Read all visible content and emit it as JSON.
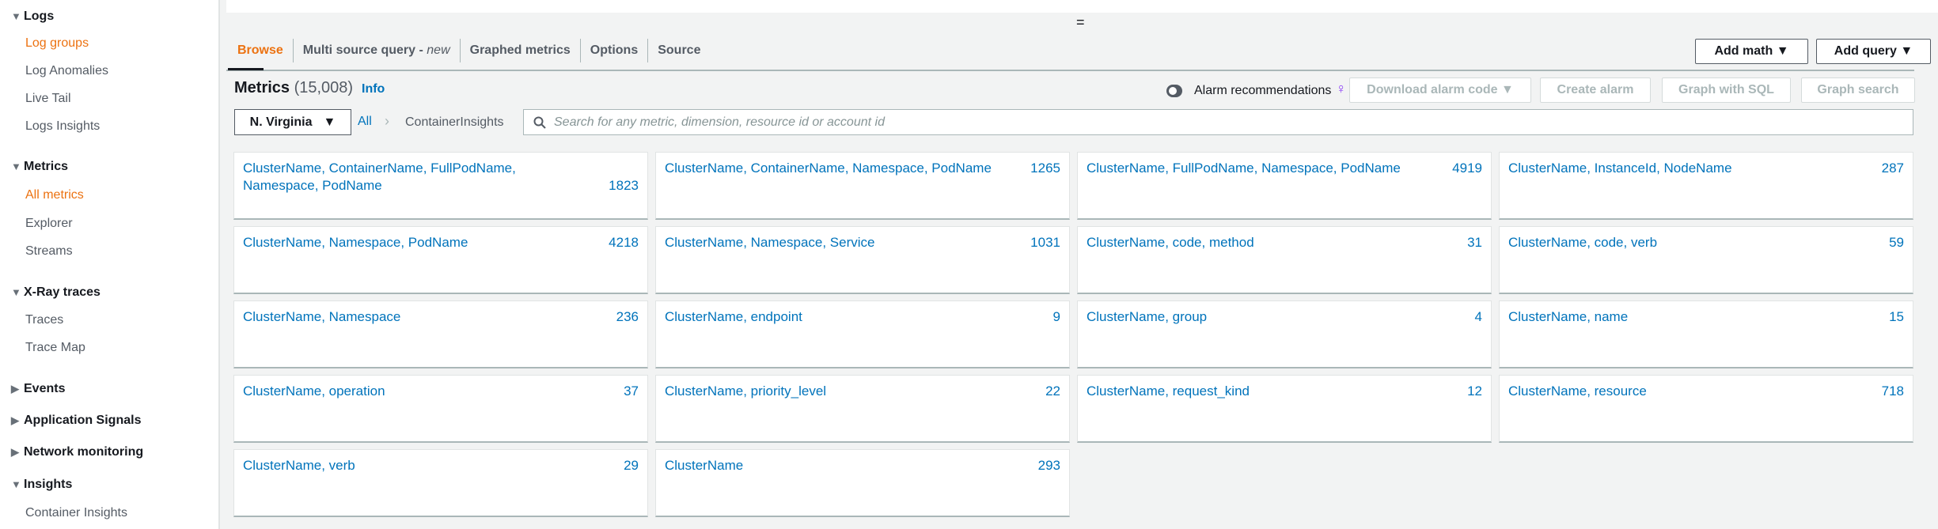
{
  "sidebar": {
    "items": [
      {
        "label": "Logs",
        "type": "header",
        "expanded": true
      },
      {
        "label": "Log groups",
        "type": "item",
        "active": true
      },
      {
        "label": "Log Anomalies",
        "type": "item"
      },
      {
        "label": "Live Tail",
        "type": "item"
      },
      {
        "label": "Logs Insights",
        "type": "item"
      },
      {
        "label": "Metrics",
        "type": "header",
        "expanded": true
      },
      {
        "label": "All metrics",
        "type": "item",
        "active": true
      },
      {
        "label": "Explorer",
        "type": "item"
      },
      {
        "label": "Streams",
        "type": "item"
      },
      {
        "label": "X-Ray traces",
        "type": "header",
        "expanded": true
      },
      {
        "label": "Traces",
        "type": "item"
      },
      {
        "label": "Trace Map",
        "type": "item"
      },
      {
        "label": "Events",
        "type": "header",
        "expanded": false
      },
      {
        "label": "Application Signals",
        "type": "header",
        "expanded": false
      },
      {
        "label": "Network monitoring",
        "type": "header",
        "expanded": false
      },
      {
        "label": "Insights",
        "type": "header",
        "expanded": true
      },
      {
        "label": "Container Insights",
        "type": "item"
      }
    ]
  },
  "handle": "=",
  "tabs": [
    {
      "label": "Browse",
      "active": true
    },
    {
      "label": "Multi source query - ",
      "suffix": "new"
    },
    {
      "label": "Graphed metrics"
    },
    {
      "label": "Options"
    },
    {
      "label": "Source"
    }
  ],
  "toolbar": {
    "add_math": "Add math ▼",
    "add_query": "Add query ▼"
  },
  "metrics": {
    "title": "Metrics",
    "count": "(15,008)",
    "info": "Info",
    "alarm_recommendations": "Alarm recommendations",
    "download_alarm_code": "Download alarm code ▼",
    "create_alarm": "Create alarm",
    "graph_with_sql": "Graph with SQL",
    "graph_search": "Graph search"
  },
  "filter": {
    "region": "N. Virginia",
    "all": "All",
    "namespace": "ContainerInsights",
    "search_placeholder": "Search for any metric, dimension, resource id or account id"
  },
  "cards": [
    {
      "name": "ClusterName, ContainerName, FullPodName, Namespace, PodName",
      "count": "1823"
    },
    {
      "name": "ClusterName, ContainerName, Namespace, PodName",
      "count": "1265"
    },
    {
      "name": "ClusterName, FullPodName, Namespace, PodName",
      "count": "4919"
    },
    {
      "name": "ClusterName, InstanceId, NodeName",
      "count": "287"
    },
    {
      "name": "ClusterName, Namespace, PodName",
      "count": "4218"
    },
    {
      "name": "ClusterName, Namespace, Service",
      "count": "1031"
    },
    {
      "name": "ClusterName, code, method",
      "count": "31"
    },
    {
      "name": "ClusterName, code, verb",
      "count": "59"
    },
    {
      "name": "ClusterName, Namespace",
      "count": "236"
    },
    {
      "name": "ClusterName, endpoint",
      "count": "9"
    },
    {
      "name": "ClusterName, group",
      "count": "4"
    },
    {
      "name": "ClusterName, name",
      "count": "15"
    },
    {
      "name": "ClusterName, operation",
      "count": "37"
    },
    {
      "name": "ClusterName, priority_level",
      "count": "22"
    },
    {
      "name": "ClusterName, request_kind",
      "count": "12"
    },
    {
      "name": "ClusterName, resource",
      "count": "718"
    },
    {
      "name": "ClusterName, verb",
      "count": "29"
    },
    {
      "name": "ClusterName",
      "count": "293"
    }
  ]
}
